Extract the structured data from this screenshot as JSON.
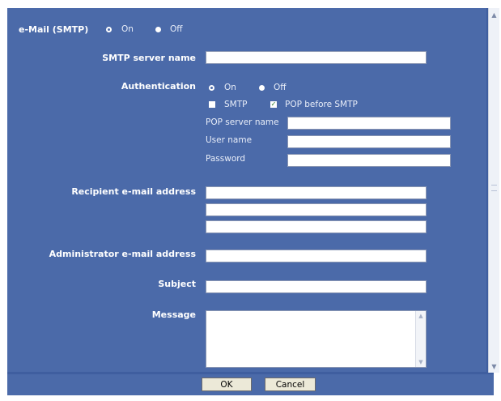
{
  "email": {
    "title": "e-Mail (SMTP)",
    "options": {
      "on": "On",
      "off": "Off"
    },
    "selected": "on"
  },
  "smtp_server": {
    "label": "SMTP server name",
    "value": ""
  },
  "authentication": {
    "label": "Authentication",
    "options": {
      "on": "On",
      "off": "Off"
    },
    "selected": "on",
    "smtp_label": "SMTP",
    "smtp_checked": false,
    "pop_before_smtp_label": "POP before SMTP",
    "pop_before_smtp_checked": true,
    "pop_server_label": "POP server name",
    "pop_server_value": "",
    "user_name_label": "User name",
    "user_name_value": "",
    "password_label": "Password",
    "password_value": ""
  },
  "recipient": {
    "label": "Recipient e-mail address",
    "values": [
      "",
      "",
      ""
    ]
  },
  "administrator": {
    "label": "Administrator e-mail address",
    "value": ""
  },
  "subject": {
    "label": "Subject",
    "value": ""
  },
  "message": {
    "label": "Message",
    "value": ""
  },
  "buttons": {
    "ok": "OK",
    "cancel": "Cancel"
  },
  "icons": {
    "scroll_up": "scroll-up-arrow",
    "scroll_down": "scroll-down-arrow",
    "check": "checkmark"
  },
  "colors": {
    "panel": "#4b6aa9",
    "frame": "#3f5e9f",
    "text": "#ffffff"
  }
}
